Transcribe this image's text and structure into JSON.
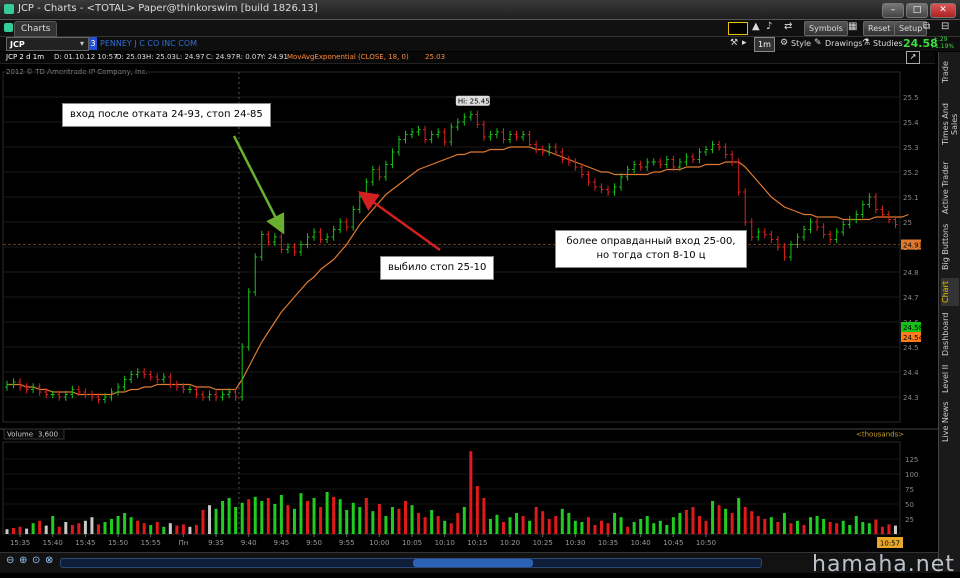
{
  "window": {
    "title": "JCP - Charts - <TOTAL> Paper@thinkorswim [build 1826.13]",
    "tab_label": "Charts",
    "toolbar": {
      "symbols": "Symbols",
      "reset": "Reset",
      "setup": "Setup"
    }
  },
  "symbol_bar": {
    "symbol": "JCP",
    "link_number": "3",
    "company": "PENNEY J C CO INC COM",
    "timeframe": "1m",
    "style": "Style",
    "drawings": "Drawings",
    "studies": "Studies",
    "last_price": "24.58",
    "change": "+.29",
    "change_pct": "+1.19%"
  },
  "info_bar": {
    "desc": "JCP 2 d 1m",
    "date": "D: 01.10.12 10:57",
    "open": "O: 25.03",
    "high": "H: 25.03",
    "low": "L: 24.97",
    "close": "C: 24.97",
    "range": "R: 0.07",
    "y": "Y: 24.91",
    "study": "MovAvgExponential (CLOSE, 18, 0)",
    "study_value": "25.03"
  },
  "copyright": "2012 © TD Ameritrade IP Company, Inc.",
  "colors": {
    "up": "#17c217",
    "down": "#e02020",
    "ema": "#e07a30",
    "vol_up": "#20cc20",
    "vol_down": "#e01a1a",
    "vol_neutral": "#c8c8c8"
  },
  "chart_data": {
    "type": "candlestick",
    "ylim": [
      24.2,
      25.6
    ],
    "y_ticks": [
      "25.5",
      "25.4",
      "25.3",
      "25.2",
      "25.1",
      "25",
      "24.9",
      "24.8",
      "24.7",
      "24.6",
      "24.5",
      "24.4",
      "24.3"
    ],
    "x_ticks": [
      "15:35",
      "15:40",
      "15:45",
      "15:50",
      "15:55",
      "Пн",
      "9:35",
      "9:40",
      "9:45",
      "9:50",
      "9:55",
      "10:00",
      "10:05",
      "10:10",
      "10:15",
      "10:20",
      "10:25",
      "10:30",
      "10:35",
      "10:40",
      "10:45",
      "10:50"
    ],
    "current_time": "10:57",
    "price_labels": {
      "cursor_level": "24.91",
      "last_green": "24.58",
      "last_orange": "24.54"
    },
    "high_label": "Hi: 25.45",
    "annotations": [
      "вход после отката 24-93, стоп 24-85",
      "выбило стоп 25-10",
      "более оправданный вход 25-00, но тогда стоп 8-10 ц"
    ],
    "ema_series": {
      "name": "MovAvgExponential (CLOSE, 18, 0)",
      "values": [
        24.35,
        24.35,
        24.35,
        24.34,
        24.34,
        24.33,
        24.33,
        24.32,
        24.32,
        24.32,
        24.32,
        24.31,
        24.31,
        24.31,
        24.31,
        24.31,
        24.31,
        24.32,
        24.32,
        24.33,
        24.33,
        24.34,
        24.34,
        24.35,
        24.35,
        24.35,
        24.35,
        24.35,
        24.35,
        24.34,
        24.34,
        24.34,
        24.33,
        24.33,
        24.33,
        24.33,
        24.37,
        24.42,
        24.47,
        24.52,
        24.56,
        24.6,
        24.64,
        24.67,
        24.7,
        24.73,
        24.76,
        24.78,
        24.81,
        24.83,
        24.85,
        24.88,
        24.91,
        24.95,
        24.99,
        25.02,
        25.05,
        25.08,
        25.11,
        25.13,
        25.15,
        25.17,
        25.19,
        25.21,
        25.22,
        25.23,
        25.24,
        25.25,
        25.26,
        25.27,
        25.27,
        25.28,
        25.28,
        25.28,
        25.29,
        25.29,
        25.29,
        25.3,
        25.3,
        25.3,
        25.3,
        25.29,
        25.29,
        25.28,
        25.27,
        25.26,
        25.25,
        25.24,
        25.23,
        25.22,
        25.21,
        25.2,
        25.2,
        25.19,
        25.19,
        25.19,
        25.19,
        25.19,
        25.19,
        25.2,
        25.2,
        25.21,
        25.21,
        25.21,
        25.22,
        25.22,
        25.22,
        25.23,
        25.23,
        25.23,
        25.24,
        25.24,
        25.24,
        25.22,
        25.19,
        25.16,
        25.13,
        25.1,
        25.08,
        25.06,
        25.05,
        25.04,
        25.03,
        25.03,
        25.02,
        25.02,
        25.02,
        25.02,
        25.01,
        25.01,
        25.01,
        25.01,
        25.01,
        25.02,
        25.02,
        25.02,
        25.02,
        25.02,
        25.03
      ]
    },
    "price_series": {
      "name": "JCP 1m",
      "close": [
        24.35,
        24.36,
        24.34,
        24.33,
        24.34,
        24.32,
        24.31,
        24.31,
        24.3,
        24.31,
        24.33,
        24.32,
        24.31,
        24.3,
        24.29,
        24.3,
        24.32,
        24.34,
        24.37,
        24.39,
        24.4,
        24.39,
        24.38,
        24.37,
        24.38,
        24.35,
        24.34,
        24.33,
        24.33,
        24.31,
        24.3,
        24.31,
        24.3,
        24.31,
        24.32,
        24.3,
        24.5,
        24.72,
        24.86,
        24.95,
        24.92,
        24.94,
        24.89,
        24.9,
        24.88,
        24.91,
        24.94,
        24.96,
        24.93,
        24.94,
        24.97,
        25.0,
        24.98,
        25.05,
        25.1,
        25.16,
        25.21,
        25.18,
        25.23,
        25.28,
        25.33,
        25.35,
        25.36,
        25.37,
        25.33,
        25.35,
        25.36,
        25.32,
        25.38,
        25.4,
        25.42,
        25.43,
        25.39,
        25.34,
        25.35,
        25.36,
        25.33,
        25.35,
        25.34,
        25.35,
        25.31,
        25.29,
        25.28,
        25.3,
        25.28,
        25.25,
        25.24,
        25.22,
        25.19,
        25.16,
        25.14,
        25.13,
        25.12,
        25.14,
        25.18,
        25.21,
        25.23,
        25.22,
        25.24,
        25.24,
        25.23,
        25.25,
        25.22,
        25.24,
        25.26,
        25.25,
        25.28,
        25.29,
        25.31,
        25.3,
        25.27,
        25.24,
        25.12,
        25.0,
        24.94,
        24.96,
        24.95,
        24.93,
        24.9,
        24.86,
        24.91,
        24.94,
        24.97,
        25.0,
        24.98,
        24.95,
        24.93,
        24.96,
        24.99,
        25.01,
        25.03,
        25.07,
        25.1,
        25.05,
        25.03,
        25.01,
        24.99
      ]
    },
    "volume": {
      "label": "Volume",
      "value": "3,600",
      "units": "<thousands>",
      "y_ticks": [
        "125",
        "100",
        "75",
        "50",
        "25"
      ],
      "ylim": [
        0,
        140
      ],
      "values": [
        8,
        10,
        12,
        9,
        18,
        22,
        14,
        30,
        12,
        20,
        15,
        18,
        22,
        28,
        16,
        20,
        25,
        30,
        35,
        28,
        22,
        18,
        15,
        20,
        12,
        18,
        14,
        16,
        12,
        15,
        40,
        48,
        42,
        55,
        60,
        45,
        52,
        58,
        62,
        55,
        60,
        50,
        65,
        48,
        42,
        68,
        55,
        60,
        45,
        70,
        62,
        58,
        40,
        52,
        45,
        60,
        38,
        50,
        30,
        45,
        42,
        55,
        48,
        35,
        28,
        40,
        30,
        22,
        18,
        35,
        45,
        138,
        80,
        60,
        25,
        32,
        20,
        28,
        35,
        30,
        22,
        45,
        38,
        25,
        30,
        42,
        35,
        22,
        20,
        28,
        15,
        22,
        18,
        35,
        28,
        12,
        20,
        25,
        30,
        18,
        22,
        15,
        28,
        35,
        40,
        45,
        30,
        22,
        55,
        48,
        42,
        35,
        60,
        45,
        38,
        30,
        25,
        28,
        20,
        35,
        18,
        22,
        15,
        28,
        30,
        25,
        20,
        18,
        22,
        15,
        30,
        20,
        18,
        24,
        12,
        16,
        14
      ],
      "directions": "nddnudnudnddnnduuuuuddudunddnddnuuuuuduuduuduudududuuuududuudduddududduddduuduududddduuuudddduuduuuuuuuuddddudududdddudududuuudduuuuudddn"
    }
  },
  "right_tabs": [
    "Trade",
    "Times And Sales",
    "Active Trader",
    "Big Buttons",
    "Chart",
    "Dashboard",
    "Level II",
    "Live News"
  ],
  "bottom_time": "10:57",
  "watermark": "hamaha.net"
}
